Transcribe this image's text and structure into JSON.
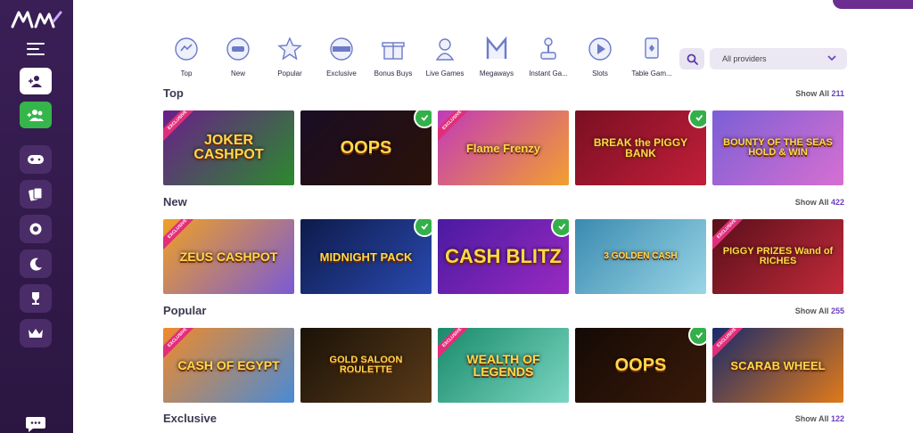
{
  "logo_text": "AW",
  "categories": [
    {
      "label": "Top",
      "icon": "top-icon"
    },
    {
      "label": "New",
      "icon": "new-icon"
    },
    {
      "label": "Popular",
      "icon": "star-icon"
    },
    {
      "label": "Exclusive",
      "icon": "exclusive-icon"
    },
    {
      "label": "Bonus Buys",
      "icon": "gift-icon"
    },
    {
      "label": "Live Games",
      "icon": "dealer-icon"
    },
    {
      "label": "Megaways",
      "icon": "megaways-icon"
    },
    {
      "label": "Instant Ga...",
      "icon": "joystick-icon"
    },
    {
      "label": "Slots",
      "icon": "play-icon"
    },
    {
      "label": "Table Gam...",
      "icon": "card-icon"
    }
  ],
  "provider_select": {
    "value": "All providers"
  },
  "sections": [
    {
      "title": "Top",
      "show_label": "Show All",
      "count": "211",
      "games": [
        {
          "title": "JOKER CASHPOT",
          "exclusive": true,
          "badge": false
        },
        {
          "title": "OOPS",
          "exclusive": false,
          "badge": true
        },
        {
          "title": "Flame Frenzy",
          "exclusive": true,
          "badge": false
        },
        {
          "title": "BREAK the PIGGY BANK",
          "exclusive": false,
          "badge": true
        },
        {
          "title": "BOUNTY OF THE SEAS HOLD & WIN",
          "exclusive": false,
          "badge": false
        }
      ]
    },
    {
      "title": "New",
      "show_label": "Show All",
      "count": "422",
      "games": [
        {
          "title": "ZEUS CASHPOT",
          "exclusive": true,
          "badge": false
        },
        {
          "title": "MIDNIGHT PACK",
          "exclusive": false,
          "badge": true
        },
        {
          "title": "CASH BLITZ",
          "exclusive": false,
          "badge": true
        },
        {
          "title": "3 GOLDEN CASH",
          "exclusive": false,
          "badge": false
        },
        {
          "title": "PIGGY PRIZES Wand of RICHES",
          "exclusive": true,
          "badge": false
        }
      ]
    },
    {
      "title": "Popular",
      "show_label": "Show All",
      "count": "255",
      "games": [
        {
          "title": "CASH OF EGYPT",
          "exclusive": true,
          "badge": false
        },
        {
          "title": "GOLD SALOON ROULETTE",
          "exclusive": false,
          "badge": false
        },
        {
          "title": "WEALTH OF LEGENDS",
          "exclusive": true,
          "badge": false
        },
        {
          "title": "OOPS",
          "exclusive": false,
          "badge": true
        },
        {
          "title": "SCARAB WHEEL",
          "exclusive": true,
          "badge": false
        }
      ]
    },
    {
      "title": "Exclusive",
      "show_label": "Show All",
      "count": "122",
      "games": []
    }
  ],
  "exclusive_ribbon": "EXCLUSIVE"
}
